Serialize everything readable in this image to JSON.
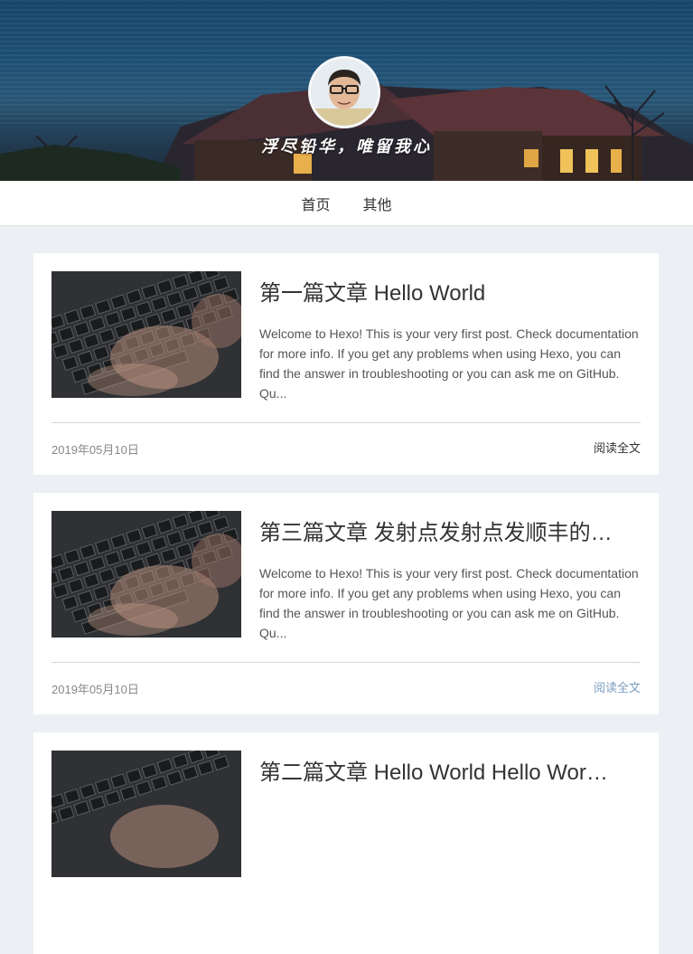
{
  "header": {
    "motto": "浮尽铅华，唯留我心"
  },
  "nav": {
    "items": [
      {
        "label": "首页"
      },
      {
        "label": "其他"
      }
    ]
  },
  "posts": [
    {
      "title": "第一篇文章 Hello World",
      "excerpt": "Welcome to Hexo! This is your very first post. Check documentation for more info. If you get any problems when using Hexo, you can find the answer in troubleshooting or you can ask me on GitHub. Qu...",
      "date": "2019年05月10日",
      "read_more": "阅读全文"
    },
    {
      "title": "第三篇文章 发射点发射点发顺丰的…",
      "excerpt": "Welcome to Hexo! This is your very first post. Check documentation for more info. If you get any problems when using Hexo, you can find the answer in troubleshooting or you can ask me on GitHub. Qu...",
      "date": "2019年05月10日",
      "read_more": "阅读全文"
    },
    {
      "title": "第二篇文章 Hello World Hello Wor…",
      "excerpt": "",
      "date": "",
      "read_more": ""
    }
  ],
  "colors": {
    "read_more_hover": "#7a9ec0",
    "page_bg": "#eceff4"
  }
}
